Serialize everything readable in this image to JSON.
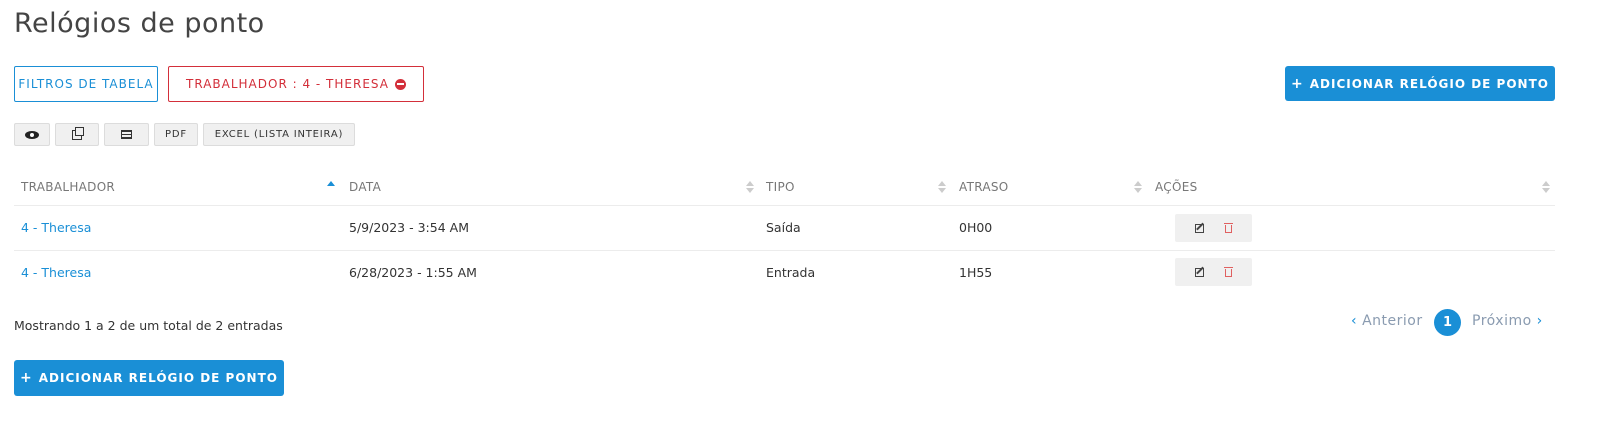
{
  "page": {
    "title": "Relógios de ponto"
  },
  "filters": {
    "table_filters_label": "FILTROS DE TABELA",
    "active_filter_label": "TRABALHADOR : 4 - THERESA"
  },
  "add_button_label": "ADICIONAR RELÓGIO DE PONTO",
  "toolbar": {
    "pdf_label": "PDF",
    "excel_label": "EXCEL (LISTA INTEIRA)",
    "icons": [
      "eye-icon",
      "copy-icon",
      "table-icon"
    ]
  },
  "table": {
    "columns": [
      "TRABALHADOR",
      "DATA",
      "TIPO",
      "ATRASO",
      "AÇÕES"
    ],
    "rows": [
      {
        "worker": "4 - Theresa",
        "date": "5/9/2023 - 3:54 AM",
        "type": "Saída",
        "delay": "0H00"
      },
      {
        "worker": "4 - Theresa",
        "date": "6/28/2023 - 1:55 AM",
        "type": "Entrada",
        "delay": "1H55"
      }
    ]
  },
  "pagination": {
    "info": "Mostrando 1 a 2 de um total de 2 entradas",
    "prev_label": "Anterior",
    "current_page": "1",
    "next_label": "Próximo"
  },
  "colors": {
    "primary": "#1a8fd6",
    "danger": "#d32f3a"
  }
}
